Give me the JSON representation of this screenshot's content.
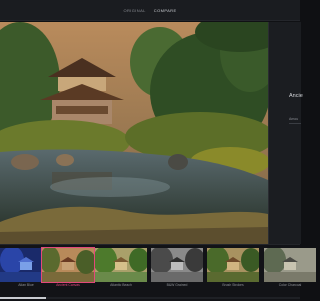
{
  "topbar": {
    "tabs": [
      {
        "label": "ORIGINAL",
        "active": false
      },
      {
        "label": "COMPARE",
        "active": true
      }
    ]
  },
  "side_panel": {
    "title": "Ancie",
    "subtitle": "Amou"
  },
  "filmstrip": {
    "selected_index": 1,
    "scroll_position": 0.0,
    "presets": [
      {
        "label": "Atlan Blue"
      },
      {
        "label": "Ancient Canvas"
      },
      {
        "label": "Atlantic Beach"
      },
      {
        "label": "B&W Grained"
      },
      {
        "label": "Brush Strokes"
      },
      {
        "label": "Color Charcoal"
      }
    ]
  },
  "colors": {
    "accent": "#e2497a",
    "background": "#101114",
    "panel": "#1b1d21"
  }
}
